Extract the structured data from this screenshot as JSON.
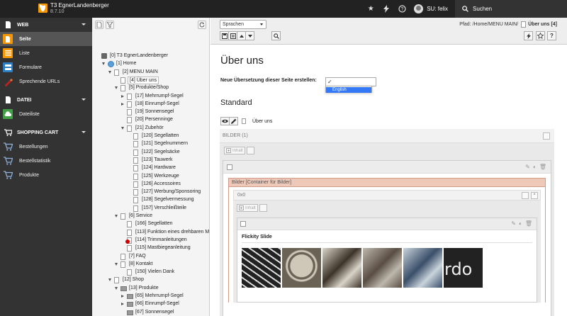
{
  "topbar": {
    "site_name": "T3 EgnerLandenberger",
    "version": "8.7.10",
    "user_label": "SU: felix",
    "search_label": "Suchen",
    "icons": [
      "star-icon",
      "bolt-icon",
      "help-icon"
    ]
  },
  "modmenu": {
    "groups": [
      {
        "label": "WEB",
        "items": [
          {
            "label": "Seite",
            "color": "#f49700"
          },
          {
            "label": "Liste",
            "color": "#f49700"
          },
          {
            "label": "Formulare",
            "color": "#2b7ec1"
          },
          {
            "label": "Sprechende URLs",
            "color": "#b8241c"
          }
        ]
      },
      {
        "label": "DATEI",
        "items": [
          {
            "label": "Dateiliste",
            "color": "#43a047"
          }
        ]
      },
      {
        "label": "SHOPPING CART",
        "items": [
          {
            "label": "Bestellungen",
            "color": "#3f5e8c"
          },
          {
            "label": "Bestellstatistik",
            "color": "#3f5e8c"
          },
          {
            "label": "Produkte",
            "color": "#3f5e8c"
          }
        ]
      }
    ]
  },
  "tree": {
    "nodes": [
      {
        "label": "[0] T3 EgnerLandenberger",
        "depth": 0,
        "icon": "t3",
        "exp": ""
      },
      {
        "label": "[1] Home",
        "depth": 1,
        "icon": "globe",
        "exp": "open"
      },
      {
        "label": "[2] MENU MAIN",
        "depth": 2,
        "icon": "page",
        "exp": "open"
      },
      {
        "label": "[4] Über uns",
        "depth": 3,
        "icon": "page",
        "exp": "",
        "selected": true
      },
      {
        "label": "[5] Produkte/Shop",
        "depth": 3,
        "icon": "page",
        "exp": "open"
      },
      {
        "label": "[17] Mehrrumpf-Segel",
        "depth": 4,
        "icon": "page",
        "exp": "closed"
      },
      {
        "label": "[18] Einrumpf-Segel",
        "depth": 4,
        "icon": "page",
        "exp": "closed"
      },
      {
        "label": "[19] Sonnensegel",
        "depth": 4,
        "icon": "page",
        "exp": ""
      },
      {
        "label": "[20] Persenninge",
        "depth": 4,
        "icon": "page",
        "exp": ""
      },
      {
        "label": "[21] Zubehör",
        "depth": 4,
        "icon": "page",
        "exp": "open"
      },
      {
        "label": "[120] Segellatten",
        "depth": 5,
        "icon": "page",
        "exp": ""
      },
      {
        "label": "[121] Segelnummern",
        "depth": 5,
        "icon": "page",
        "exp": ""
      },
      {
        "label": "[122] Segelsäcke",
        "depth": 5,
        "icon": "page",
        "exp": ""
      },
      {
        "label": "[123] Tauwerk",
        "depth": 5,
        "icon": "page",
        "exp": ""
      },
      {
        "label": "[124] Hardware",
        "depth": 5,
        "icon": "page",
        "exp": ""
      },
      {
        "label": "[125] Werkzeuge",
        "depth": 5,
        "icon": "page",
        "exp": ""
      },
      {
        "label": "[126] Accessoires",
        "depth": 5,
        "icon": "page",
        "exp": ""
      },
      {
        "label": "[127] Werbung/Sponsoring",
        "depth": 5,
        "icon": "page",
        "exp": ""
      },
      {
        "label": "[128] Segelvermessung",
        "depth": 5,
        "icon": "page",
        "exp": ""
      },
      {
        "label": "[157] Verschleißteile",
        "depth": 5,
        "icon": "page",
        "exp": ""
      },
      {
        "label": "[6] Service",
        "depth": 3,
        "icon": "page",
        "exp": "open"
      },
      {
        "label": "[166] Segellatten",
        "depth": 4,
        "icon": "page",
        "exp": ""
      },
      {
        "label": "[113] Funktion eines drehbaren M",
        "depth": 4,
        "icon": "page",
        "exp": ""
      },
      {
        "label": "[114] Trimmanleitungen",
        "depth": 4,
        "icon": "page-mark",
        "exp": ""
      },
      {
        "label": "[115] Mastbiegeanleitung",
        "depth": 4,
        "icon": "page",
        "exp": ""
      },
      {
        "label": "[7] FAQ",
        "depth": 3,
        "icon": "page",
        "exp": ""
      },
      {
        "label": "[8] Kontakt",
        "depth": 3,
        "icon": "page",
        "exp": "open"
      },
      {
        "label": "[150] Vielen Dank",
        "depth": 4,
        "icon": "page",
        "exp": ""
      },
      {
        "label": "[12] Shop",
        "depth": 2,
        "icon": "page",
        "exp": "open"
      },
      {
        "label": "[13] Produkte",
        "depth": 3,
        "icon": "folder",
        "exp": "open"
      },
      {
        "label": "[65] Mehrrumpf-Segel",
        "depth": 4,
        "icon": "folder",
        "exp": "closed"
      },
      {
        "label": "[66] Einrumpf-Segel",
        "depth": 4,
        "icon": "folder",
        "exp": "closed"
      },
      {
        "label": "[67] Sonnensegel",
        "depth": 4,
        "icon": "folder",
        "exp": ""
      }
    ]
  },
  "docheader": {
    "language_select": "Sprachen",
    "path_label": "Pfad: /Home/MENU MAIN/",
    "path_current": "Über uns [4]"
  },
  "main": {
    "page_title": "Über uns",
    "translation_label": "Neue Übersetzung dieser Seite erstellen:",
    "translation_check": "✓",
    "dropdown_option": "English",
    "column_title": "Standard",
    "page_name": "Über uns",
    "ce_header": "BILDER (1)",
    "inhalt_label": "Inhalt",
    "container_title": "Bilder [Container für Bilder]",
    "grid_label": "0x0",
    "slide_title": "Flickity Slide"
  },
  "thumbnails": [
    {
      "name": "rope-thumb",
      "colors": [
        "#222",
        "#ddd"
      ]
    },
    {
      "name": "gauge-thumb",
      "colors": [
        "#6b6256",
        "#cfc8b8"
      ]
    },
    {
      "name": "shackle-thumb",
      "colors": [
        "#3d3328",
        "#d9d4c9"
      ]
    },
    {
      "name": "needle-thumb",
      "colors": [
        "#5a4e44",
        "#bdb7ac"
      ]
    },
    {
      "name": "clamp-thumb",
      "colors": [
        "#3a4f6a",
        "#c9d3db"
      ]
    },
    {
      "name": "logo-thumb",
      "colors": [
        "#222",
        "#eee"
      ]
    }
  ]
}
